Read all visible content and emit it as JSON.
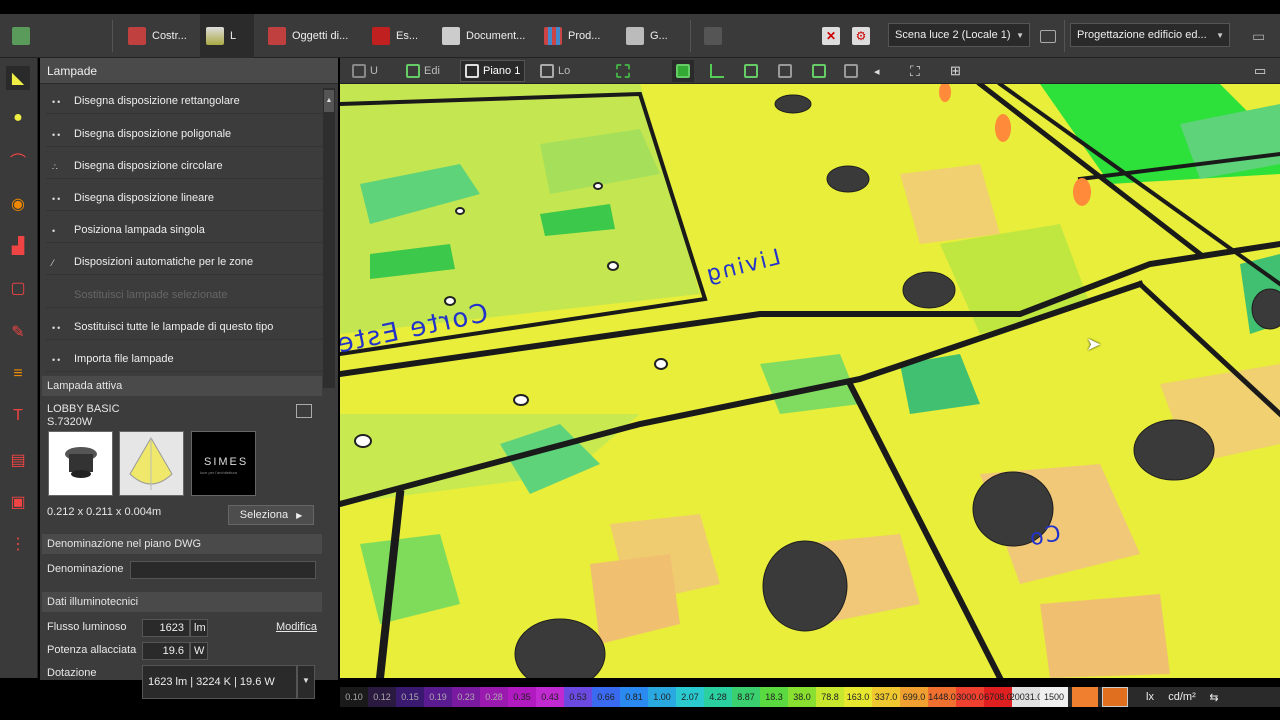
{
  "toolbar": {
    "items": [
      "Costr...",
      "L",
      "Oggetti di...",
      "Es...",
      "Document...",
      "Prod...",
      "G..."
    ],
    "scene_select": "Scena luce 2 (Locale 1)",
    "project_select": "Progettazione edificio ed..."
  },
  "view_toolbar": {
    "items": [
      "U",
      "Edi",
      "Piano 1",
      "Lo"
    ]
  },
  "panel": {
    "title": "Lampade",
    "menu": [
      "Disegna disposizione rettangolare",
      "Disegna disposizione poligonale",
      "Disegna disposizione circolare",
      "Disegna disposizione lineare",
      "Posiziona lampada singola",
      "Disposizioni automatiche per le zone",
      "Sostituisci lampade selezionate",
      "Sostituisci tutte le lampade di questo tipo",
      "Importa file lampade"
    ],
    "active_lamp": {
      "section": "Lampada attiva",
      "name": "LOBBY BASIC",
      "code": "S.7320W",
      "dims": "0.212 x 0.211 x 0.004m",
      "select_btn": "Seleziona",
      "brand": "SIMES",
      "brand_sub": "luce per l'architettura"
    },
    "dwg": {
      "section": "Denominazione nel piano DWG",
      "label": "Denominazione",
      "value": ""
    },
    "photometric": {
      "section": "Dati illuminotecnici",
      "flux_label": "Flusso luminoso",
      "flux_value": "1623",
      "flux_unit": "lm",
      "edit_link": "Modifica",
      "power_label": "Potenza allacciata",
      "power_value": "19.6",
      "power_unit": "W",
      "equip_label": "Dotazione",
      "equip_value": "1623 lm  |  3224 K  |  19.6 W"
    }
  },
  "viewport": {
    "labels": [
      "Corte Este",
      "Living",
      "Co"
    ]
  },
  "legend": {
    "values": [
      "0.10",
      "0.12",
      "0.15",
      "0.19",
      "0.23",
      "0.28",
      "0.35",
      "0.43",
      "0.53",
      "0.66",
      "0.81",
      "1.00",
      "2.07",
      "4.28",
      "8.87",
      "18.3",
      "38.0",
      "78.8",
      "163.0",
      "337.0",
      "699.0",
      "1448.0",
      "3000.0",
      "6708.0",
      "20031.0",
      "1500"
    ],
    "colors": [
      "#1a1a1a",
      "#2a1a40",
      "#3a1a70",
      "#5a1a90",
      "#7a1aa0",
      "#9a1ab0",
      "#b01ac0",
      "#c02ad0",
      "#6a4ae0",
      "#3a6af0",
      "#2a8af0",
      "#2aa8e0",
      "#2acad0",
      "#2ad0a0",
      "#3ad070",
      "#5ada40",
      "#8ae030",
      "#c8e830",
      "#e8e830",
      "#f0c830",
      "#f0a030",
      "#f07030",
      "#f04030",
      "#e02020",
      "#e0e0e0",
      "#f0f0f0"
    ],
    "unit_lx": "lx",
    "unit_cd": "cd/m²"
  }
}
